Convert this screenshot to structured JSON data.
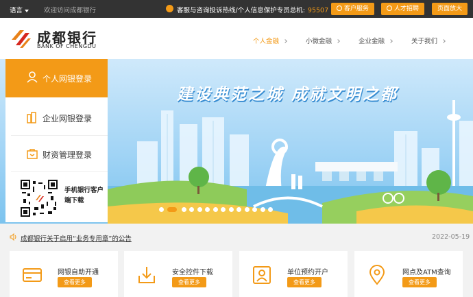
{
  "topbar": {
    "language": "语言",
    "welcome": "欢迎访问成都银行",
    "hotline_label": "客服与咨询投诉热线/个人信息保护专员总机:",
    "hotline_number": "95507",
    "buttons": [
      "客户服务",
      "人才招聘",
      "页面放大"
    ]
  },
  "header": {
    "logo_cn": "成都银行",
    "logo_en": "BANK OF CHENGDU",
    "nav": [
      {
        "label": "个人金融",
        "active": true
      },
      {
        "label": "小微金融",
        "active": false
      },
      {
        "label": "企业金融",
        "active": false
      },
      {
        "label": "关于我们",
        "active": false
      }
    ]
  },
  "login_panel": {
    "items": [
      "个人网银登录",
      "企业网银登录",
      "财资管理登录"
    ],
    "qr_label": "手机银行客户端下载"
  },
  "banner": {
    "headline": "建设典范之城   成就文明之都",
    "slide_count": 14,
    "active_slide": 1
  },
  "notice": {
    "text": "成都银行关于启用“业务专用章”的公告",
    "date": "2022-05-19"
  },
  "services": [
    {
      "title": "网银自助开通",
      "button": "查看更多",
      "icon": "card-icon"
    },
    {
      "title": "安全控件下载",
      "button": "查看更多",
      "icon": "download-icon"
    },
    {
      "title": "单位预约开户",
      "button": "查看更多",
      "icon": "id-card-icon"
    },
    {
      "title": "网点及ATM查询",
      "button": "查看更多",
      "icon": "location-pin-icon"
    }
  ],
  "colors": {
    "accent": "#f39a17",
    "topbar": "#333333",
    "sky": "#9fd3f5"
  }
}
